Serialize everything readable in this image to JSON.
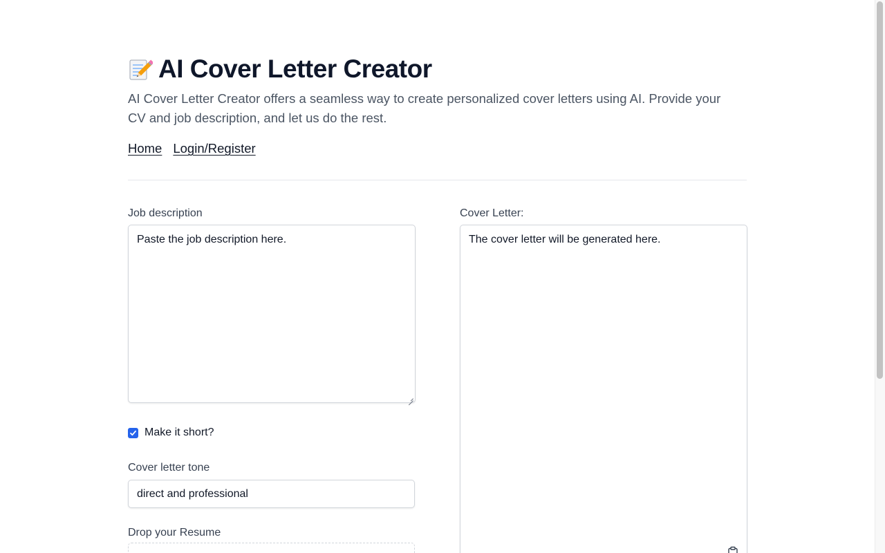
{
  "header": {
    "title": "AI Cover Letter Creator",
    "title_icon": "memo-pencil-icon",
    "subtitle": "AI Cover Letter Creator offers a seamless way to create personalized cover letters using AI. Provide your CV and job description, and let us do the rest."
  },
  "nav": {
    "items": [
      {
        "label": "Home"
      },
      {
        "label": "Login/Register"
      }
    ]
  },
  "form": {
    "job_description_label": "Job description",
    "job_description_placeholder": "Paste the job description here.",
    "short_checkbox_label": "Make it short?",
    "short_checked": true,
    "tone_label": "Cover letter tone",
    "tone_value": "direct and professional",
    "resume_label": "Drop your Resume"
  },
  "output": {
    "label": "Cover Letter:",
    "placeholder": "The cover letter will be generated here.",
    "copy_icon": "clipboard-icon"
  },
  "colors": {
    "accent": "#2563eb",
    "title": "#0f172a",
    "muted_text": "#4b5563",
    "border": "#d1d5db"
  }
}
